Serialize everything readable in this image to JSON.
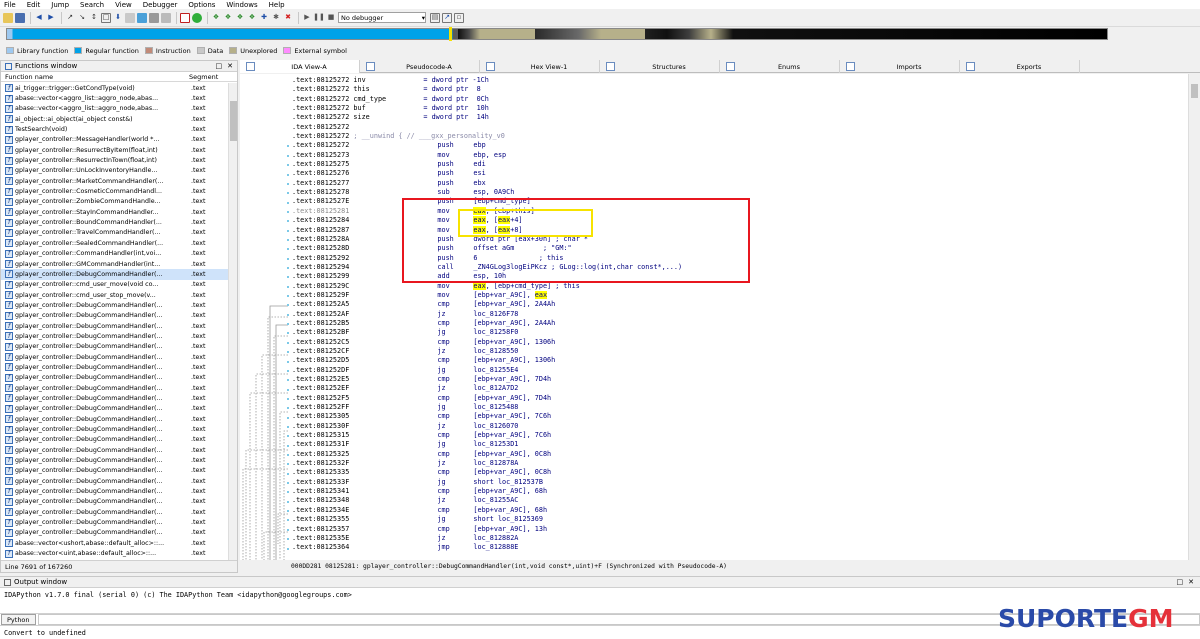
{
  "menu": [
    "File",
    "Edit",
    "Jump",
    "Search",
    "View",
    "Debugger",
    "Options",
    "Windows",
    "Help"
  ],
  "toolbar": {
    "debugger_select": "No debugger"
  },
  "legend": [
    {
      "label": "Library function",
      "color": "#9ec9f0"
    },
    {
      "label": "Regular function",
      "color": "#00a2e8"
    },
    {
      "label": "Instruction",
      "color": "#c18a78"
    },
    {
      "label": "Data",
      "color": "#c8c8c8"
    },
    {
      "label": "Unexplored",
      "color": "#b6b08a"
    },
    {
      "label": "External symbol",
      "color": "#ff8cff"
    }
  ],
  "functions_window": {
    "title": "Functions window",
    "col_name": "Function name",
    "col_segment": "Segment",
    "status": "Line 7691 of 167260",
    "rows": [
      {
        "name": "ai_trigger::trigger::GetCondType(void)",
        "seg": ".text"
      },
      {
        "name": "abase::vector<aggro_list::aggro_node,abas...",
        "seg": ".text"
      },
      {
        "name": "abase::vector<aggro_list::aggro_node,abas...",
        "seg": ".text"
      },
      {
        "name": "ai_object::ai_object(ai_object const&)",
        "seg": ".text"
      },
      {
        "name": "TestSearch(void)",
        "seg": ".text"
      },
      {
        "name": "gplayer_controller::MessageHandler(world *...",
        "seg": ".text"
      },
      {
        "name": "gplayer_controller::ResurrectByItem(float,int)",
        "seg": ".text"
      },
      {
        "name": "gplayer_controller::ResurrectInTown(float,int)",
        "seg": ".text"
      },
      {
        "name": "gplayer_controller::UnLockInventoryHandle...",
        "seg": ".text"
      },
      {
        "name": "gplayer_controller::MarketCommandHandler(...",
        "seg": ".text"
      },
      {
        "name": "gplayer_controller::CosmeticCommandHandl...",
        "seg": ".text"
      },
      {
        "name": "gplayer_controller::ZombieCommandHandle...",
        "seg": ".text"
      },
      {
        "name": "gplayer_controller::StayInCommandHandler...",
        "seg": ".text"
      },
      {
        "name": "gplayer_controller::BoundCommandHandler(...",
        "seg": ".text"
      },
      {
        "name": "gplayer_controller::TravelCommandHandler(...",
        "seg": ".text"
      },
      {
        "name": "gplayer_controller::SealedCommandHandler(...",
        "seg": ".text"
      },
      {
        "name": "gplayer_controller::CommandHandler(int,voi...",
        "seg": ".text"
      },
      {
        "name": "gplayer_controller::GMCommandHandler(int...",
        "seg": ".text"
      },
      {
        "name": "gplayer_controller::DebugCommandHandler(...",
        "seg": ".text"
      },
      {
        "name": "gplayer_controller::cmd_user_move(void co...",
        "seg": ".text"
      },
      {
        "name": "gplayer_controller::cmd_user_stop_move(v...",
        "seg": ".text"
      },
      {
        "name": "gplayer_controller::DebugCommandHandler(...",
        "seg": ".text"
      },
      {
        "name": "gplayer_controller::DebugCommandHandler(...",
        "seg": ".text"
      },
      {
        "name": "gplayer_controller::DebugCommandHandler(...",
        "seg": ".text"
      },
      {
        "name": "gplayer_controller::DebugCommandHandler(...",
        "seg": ".text"
      },
      {
        "name": "gplayer_controller::DebugCommandHandler(...",
        "seg": ".text"
      },
      {
        "name": "gplayer_controller::DebugCommandHandler(...",
        "seg": ".text"
      },
      {
        "name": "gplayer_controller::DebugCommandHandler(...",
        "seg": ".text"
      },
      {
        "name": "gplayer_controller::DebugCommandHandler(...",
        "seg": ".text"
      },
      {
        "name": "gplayer_controller::DebugCommandHandler(...",
        "seg": ".text"
      },
      {
        "name": "gplayer_controller::DebugCommandHandler(...",
        "seg": ".text"
      },
      {
        "name": "gplayer_controller::DebugCommandHandler(...",
        "seg": ".text"
      },
      {
        "name": "gplayer_controller::DebugCommandHandler(...",
        "seg": ".text"
      },
      {
        "name": "gplayer_controller::DebugCommandHandler(...",
        "seg": ".text"
      },
      {
        "name": "gplayer_controller::DebugCommandHandler(...",
        "seg": ".text"
      },
      {
        "name": "gplayer_controller::DebugCommandHandler(...",
        "seg": ".text"
      },
      {
        "name": "gplayer_controller::DebugCommandHandler(...",
        "seg": ".text"
      },
      {
        "name": "gplayer_controller::DebugCommandHandler(...",
        "seg": ".text"
      },
      {
        "name": "gplayer_controller::DebugCommandHandler(...",
        "seg": ".text"
      },
      {
        "name": "gplayer_controller::DebugCommandHandler(...",
        "seg": ".text"
      },
      {
        "name": "gplayer_controller::DebugCommandHandler(...",
        "seg": ".text"
      },
      {
        "name": "gplayer_controller::DebugCommandHandler(...",
        "seg": ".text"
      },
      {
        "name": "gplayer_controller::DebugCommandHandler(...",
        "seg": ".text"
      },
      {
        "name": "gplayer_controller::DebugCommandHandler(...",
        "seg": ".text"
      },
      {
        "name": "abase::vector<ushort,abase::default_alloc>::...",
        "seg": ".text"
      },
      {
        "name": "abase::vector<uint,abase::default_alloc>::...",
        "seg": ".text"
      },
      {
        "name": "ForceGlobalDataMan::GetData(uint &,void co...",
        "seg": ".text"
      },
      {
        "name": "ForceGlobalDataMan::Dump(ForceGlobalDat...",
        "seg": ".text"
      }
    ]
  },
  "tabs": [
    "IDA View-A",
    "Pseudocode-A",
    "Hex View-1",
    "Structures",
    "Enums",
    "Imports",
    "Exports"
  ],
  "code": [
    {
      "addr": ".text:08125272",
      "mn": "inv",
      "op": "= dword ptr -1Ch"
    },
    {
      "addr": ".text:08125272",
      "mn": "this",
      "op": "= dword ptr  8"
    },
    {
      "addr": ".text:08125272",
      "mn": "cmd_type",
      "op": "= dword ptr  0Ch"
    },
    {
      "addr": ".text:08125272",
      "mn": "buf",
      "op": "= dword ptr  10h"
    },
    {
      "addr": ".text:08125272",
      "mn": "size",
      "op": "= dword ptr  14h"
    },
    {
      "addr": ".text:08125272",
      "mn": "",
      "op": ""
    },
    {
      "addr": ".text:08125272",
      "mn": "; __unwind { // ___gxx_personality_v0",
      "op": ""
    },
    {
      "addr": ".text:08125272",
      "mn": "push",
      "op": "ebp"
    },
    {
      "addr": ".text:08125273",
      "mn": "mov",
      "op": "ebp, esp"
    },
    {
      "addr": ".text:08125275",
      "mn": "push",
      "op": "edi"
    },
    {
      "addr": ".text:08125276",
      "mn": "push",
      "op": "esi"
    },
    {
      "addr": ".text:08125277",
      "mn": "push",
      "op": "ebx"
    },
    {
      "addr": ".text:08125278",
      "mn": "sub",
      "op": "esp, 0A9Ch"
    },
    {
      "addr": ".text:0812527E",
      "mn": "push",
      "op": "[ebp+cmd_type]"
    },
    {
      "addr": ".text:08125281",
      "mn": "mov",
      "op": "eax, [ebp+this]"
    },
    {
      "addr": ".text:08125284",
      "mn": "mov",
      "op": "eax, [eax+4]"
    },
    {
      "addr": ".text:08125287",
      "mn": "mov",
      "op": "eax, [eax+8]"
    },
    {
      "addr": ".text:0812528A",
      "mn": "push",
      "op": "dword ptr [eax+30h] ; char *"
    },
    {
      "addr": ".text:0812528D",
      "mn": "push",
      "op": "offset aGm       ; \"GM:\""
    },
    {
      "addr": ".text:08125292",
      "mn": "push",
      "op": "6               ; this"
    },
    {
      "addr": ".text:08125294",
      "mn": "call",
      "op": "_ZN4GLog3logEiPKcz ; GLog::log(int,char const*,...)"
    },
    {
      "addr": ".text:08125299",
      "mn": "add",
      "op": "esp, 10h"
    },
    {
      "addr": ".text:0812529C",
      "mn": "mov",
      "op": "eax, [ebp+cmd_type] ; this"
    },
    {
      "addr": ".text:0812529F",
      "mn": "mov",
      "op": "[ebp+var_A9C], eax"
    },
    {
      "addr": ".text:081252A5",
      "mn": "cmp",
      "op": "[ebp+var_A9C], 2A4Ah"
    },
    {
      "addr": ".text:081252AF",
      "mn": "jz",
      "op": "loc_8126F78"
    },
    {
      "addr": ".text:081252B5",
      "mn": "cmp",
      "op": "[ebp+var_A9C], 2A4Ah"
    },
    {
      "addr": ".text:081252BF",
      "mn": "jg",
      "op": "loc_81258F0"
    },
    {
      "addr": ".text:081252C5",
      "mn": "cmp",
      "op": "[ebp+var_A9C], 1306h"
    },
    {
      "addr": ".text:081252CF",
      "mn": "jz",
      "op": "loc_8128550"
    },
    {
      "addr": ".text:081252D5",
      "mn": "cmp",
      "op": "[ebp+var_A9C], 1306h"
    },
    {
      "addr": ".text:081252DF",
      "mn": "jg",
      "op": "loc_81255E4"
    },
    {
      "addr": ".text:081252E5",
      "mn": "cmp",
      "op": "[ebp+var_A9C], 7D4h"
    },
    {
      "addr": ".text:081252EF",
      "mn": "jz",
      "op": "loc_812A7D2"
    },
    {
      "addr": ".text:081252F5",
      "mn": "cmp",
      "op": "[ebp+var_A9C], 7D4h"
    },
    {
      "addr": ".text:081252FF",
      "mn": "jg",
      "op": "loc_8125488"
    },
    {
      "addr": ".text:08125305",
      "mn": "cmp",
      "op": "[ebp+var_A9C], 7C6h"
    },
    {
      "addr": ".text:0812530F",
      "mn": "jz",
      "op": "loc_8126070"
    },
    {
      "addr": ".text:08125315",
      "mn": "cmp",
      "op": "[ebp+var_A9C], 7C6h"
    },
    {
      "addr": ".text:0812531F",
      "mn": "jg",
      "op": "loc_81253D1"
    },
    {
      "addr": ".text:08125325",
      "mn": "cmp",
      "op": "[ebp+var_A9C], 0C8h"
    },
    {
      "addr": ".text:0812532F",
      "mn": "jz",
      "op": "loc_812878A"
    },
    {
      "addr": ".text:08125335",
      "mn": "cmp",
      "op": "[ebp+var_A9C], 0C8h"
    },
    {
      "addr": ".text:0812533F",
      "mn": "jg",
      "op": "short loc_812537B"
    },
    {
      "addr": ".text:08125341",
      "mn": "cmp",
      "op": "[ebp+var_A9C], 68h"
    },
    {
      "addr": ".text:08125348",
      "mn": "jz",
      "op": "loc_81255AC"
    },
    {
      "addr": ".text:0812534E",
      "mn": "cmp",
      "op": "[ebp+var_A9C], 68h"
    },
    {
      "addr": ".text:08125355",
      "mn": "jg",
      "op": "short loc_8125369"
    },
    {
      "addr": ".text:08125357",
      "mn": "cmp",
      "op": "[ebp+var_A9C], 13h"
    },
    {
      "addr": ".text:0812535E",
      "mn": "jz",
      "op": "loc_812882A"
    },
    {
      "addr": ".text:08125364",
      "mn": "jmp",
      "op": "loc_812888E"
    }
  ],
  "code_status": "000DD281 08125281: gplayer_controller::DebugCommandHandler(int,void const*,uint)+F  (Synchronized with Pseudocode-A)",
  "output_window": {
    "title": "Output window",
    "text": "IDAPython v1.7.0 final (serial 0) (c) The IDAPython Team <idapython@googlegroups.com>",
    "python_label": "Python",
    "status": "Convert to undefined"
  },
  "watermark": {
    "part1": "SUPORTE",
    "part2": "GM"
  }
}
